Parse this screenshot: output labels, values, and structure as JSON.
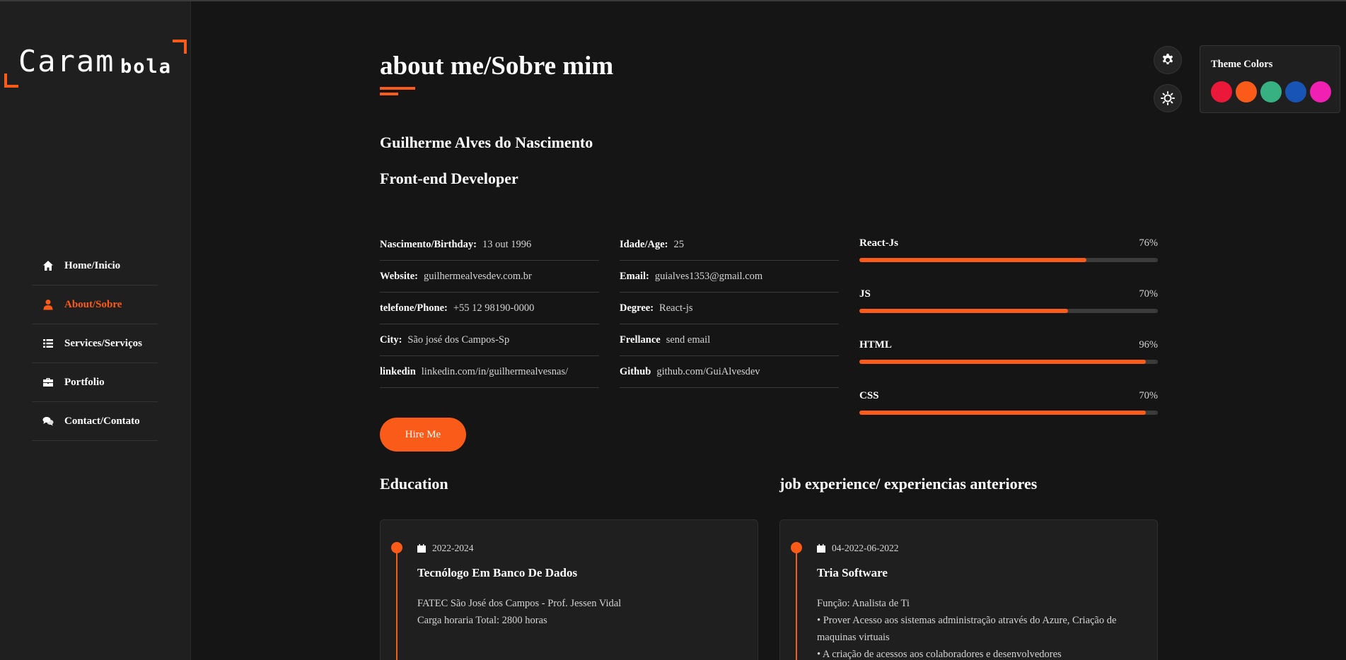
{
  "logo": {
    "main": "Caram",
    "sub": "bola"
  },
  "nav": [
    {
      "label": "Home/Inicio",
      "icon": "home-icon",
      "active": false
    },
    {
      "label": "About/Sobre",
      "icon": "user-icon",
      "active": true
    },
    {
      "label": "Services/Serviços",
      "icon": "list-icon",
      "active": false
    },
    {
      "label": "Portfolio",
      "icon": "briefcase-icon",
      "active": false
    },
    {
      "label": "Contact/Contato",
      "icon": "comments-icon",
      "active": false
    }
  ],
  "about": {
    "title": "about me/Sobre mim",
    "name": "Guilherme Alves do Nascimento",
    "role": "Front-end Developer",
    "info_left": [
      {
        "label": "Nascimento/Birthday:",
        "value": "13 out 1996"
      },
      {
        "label": "Website:",
        "value": "guilhermealvesdev.com.br"
      },
      {
        "label": "telefone/Phone:",
        "value": "+55 12 98190-0000"
      },
      {
        "label": "City:",
        "value": "São josé dos Campos-Sp"
      },
      {
        "label": "linkedin",
        "value": "linkedin.com/in/guilhermealvesnas/"
      }
    ],
    "info_right": [
      {
        "label": "Idade/Age:",
        "value": "25"
      },
      {
        "label": "Email:",
        "value": "guialves1353@gmail.com"
      },
      {
        "label": "Degree:",
        "value": "React-js"
      },
      {
        "label": "Frellance",
        "value": "send email"
      },
      {
        "label": "Github",
        "value": "github.com/GuiAlvesdev"
      }
    ],
    "skills": [
      {
        "name": "React-Js",
        "percent_label": "76%",
        "level": 0.76
      },
      {
        "name": "JS",
        "percent_label": "70%",
        "level": 0.7
      },
      {
        "name": "HTML",
        "percent_label": "96%",
        "level": 0.96
      },
      {
        "name": "CSS",
        "percent_label": "70%",
        "level": 0.96
      }
    ],
    "hire_label": "Hire Me"
  },
  "education": {
    "title": "Education",
    "date": "2022-2024",
    "item_title": "Tecnólogo Em Banco De Dados",
    "lines": [
      "FATEC São José dos Campos - Prof. Jessen Vidal",
      "Carga horaria Total: 2800 horas"
    ]
  },
  "job": {
    "title": "job experience/ experiencias anteriores",
    "date": "04-2022-06-2022",
    "item_title": "Tria Software",
    "lines": [
      "Função: Analista de Ti",
      "• Prover Acesso aos sistemas administração através do Azure, Criação de maquinas virtuais",
      "• A criação de acessos aos colaboradores e desenvolvedores"
    ]
  },
  "theme": {
    "title": "Theme Colors",
    "accent": "#fa5b18",
    "swatches": [
      "#ec1839",
      "#fa5b18",
      "#37b182",
      "#1854b4",
      "#f021b2"
    ]
  }
}
